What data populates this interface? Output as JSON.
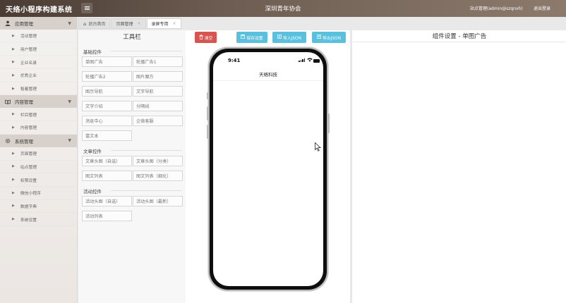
{
  "app": {
    "title": "天络小程序构建系统",
    "org": "深圳青年协会",
    "user": "站点管理(admin@szqnxh)",
    "logout": "退出登录"
  },
  "sidebar": {
    "groups": [
      {
        "label": "应用管理",
        "icon": "user-icon",
        "items": [
          "活动管理",
          "用户管理",
          "企业名录",
          "优秀企业",
          "租着管理"
        ]
      },
      {
        "label": "内容管理",
        "icon": "book-icon",
        "items": [
          "栏目管理",
          "内容管理"
        ]
      },
      {
        "label": "系统管理",
        "icon": "gear-icon",
        "items": [
          "页面管理",
          "站点管理",
          "权限设置",
          "微信小程序",
          "数据字典",
          "系统设置"
        ]
      }
    ]
  },
  "tabs": [
    {
      "label": "后台首页",
      "icon": "home-icon",
      "closable": false
    },
    {
      "label": "页面管理",
      "closable": true
    },
    {
      "label": "录屏专用",
      "closable": true,
      "active": true
    }
  ],
  "toolbar": {
    "title": "工具栏",
    "sections": [
      {
        "title": "基础控件",
        "buttons": [
          "单图广告",
          "轮播广告1",
          "轮播广告2",
          "图片魔方",
          "图示导航",
          "文字导航",
          "文字介绍",
          "分隔线",
          "消息中心",
          "企微客服",
          "富文本"
        ]
      },
      {
        "title": "文章控件",
        "buttons": [
          "文章头图（自选）",
          "文章头图（分类）",
          "图文列表",
          "图文列表（细化）"
        ]
      },
      {
        "title": "活动控件",
        "buttons": [
          "活动头图（自选）",
          "活动头图（最新）",
          "活动列表"
        ]
      }
    ]
  },
  "actions": {
    "clear": "清空",
    "save": "保存设置",
    "import": "导入JSON",
    "export": "导出JSON"
  },
  "phone": {
    "time": "9:41",
    "title": "天络科技"
  },
  "settings": {
    "title": "组件设置 - 单图广告"
  },
  "colors": {
    "topbar_dark": "#4a3c34",
    "danger": "#d9534f",
    "info": "#5bc0de"
  }
}
